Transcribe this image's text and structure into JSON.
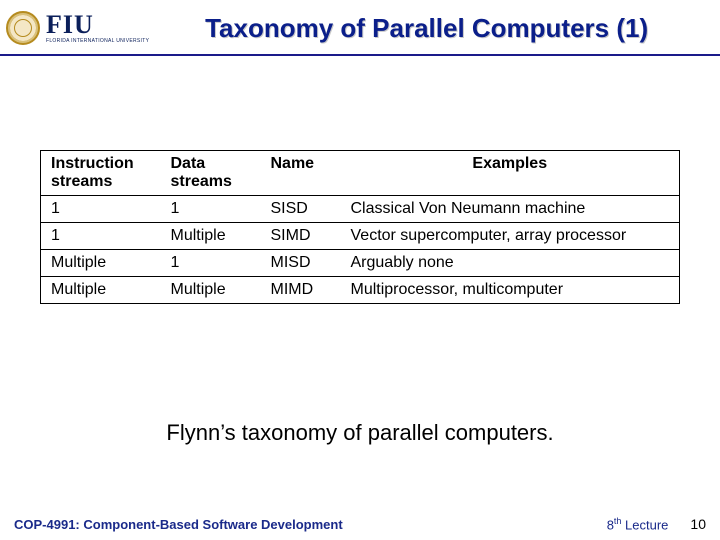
{
  "header": {
    "logo_text": "FIU",
    "logo_sub": "FLORIDA INTERNATIONAL UNIVERSITY",
    "title": "Taxonomy of Parallel Computers (1)"
  },
  "table": {
    "headers": {
      "c1a": "Instruction",
      "c1b": "streams",
      "c2a": "Data",
      "c2b": "streams",
      "c3": "Name",
      "c4": "Examples"
    },
    "rows": [
      {
        "c1": "1",
        "c2": "1",
        "c3": "SISD",
        "c4": "Classical Von Neumann machine"
      },
      {
        "c1": "1",
        "c2": "Multiple",
        "c3": "SIMD",
        "c4": "Vector supercomputer, array processor"
      },
      {
        "c1": "Multiple",
        "c2": "1",
        "c3": "MISD",
        "c4": "Arguably none"
      },
      {
        "c1": "Multiple",
        "c2": "Multiple",
        "c3": "MIMD",
        "c4": "Multiprocessor, multicomputer"
      }
    ]
  },
  "caption": "Flynn’s taxonomy of parallel computers.",
  "footer": {
    "course": "COP-4991: Component-Based Software Development",
    "lecture_ord": "8",
    "lecture_suffix": "th",
    "lecture_word": " Lecture",
    "page": "10"
  }
}
